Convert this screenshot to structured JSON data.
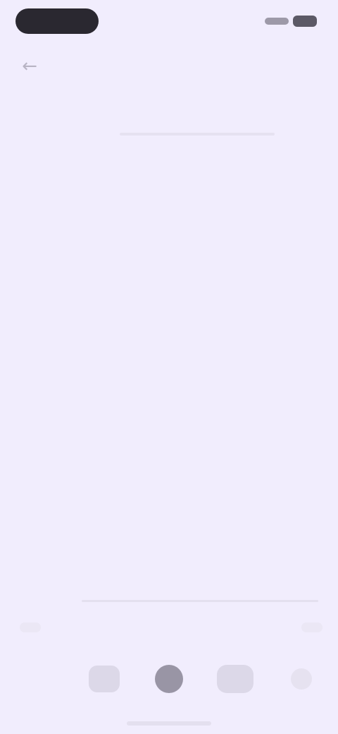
{
  "status_bar": {
    "icons": [
      "signal-icon",
      "battery-icon"
    ]
  },
  "top_bar": {
    "back_icon": "←",
    "title": ""
  },
  "article": {
    "kicker": "",
    "meta": "",
    "headline": "",
    "body": ""
  },
  "bottom": {
    "label": "",
    "center_text": ""
  },
  "nav": {
    "items": [
      "nav-item-1",
      "nav-item-2",
      "nav-item-3",
      "nav-item-4"
    ]
  },
  "colors": {
    "background": "#f1edfd",
    "headline": "#3f3c48",
    "muted": "#b9b5c5"
  }
}
